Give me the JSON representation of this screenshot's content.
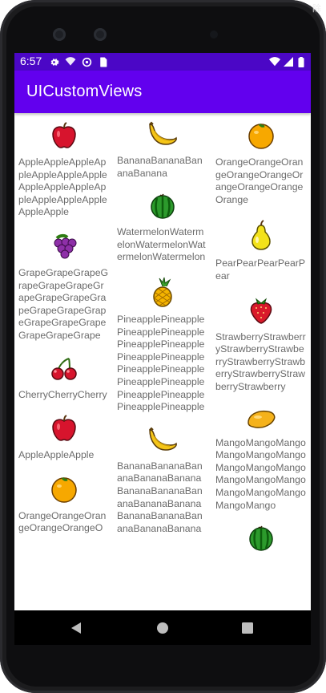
{
  "system": {
    "time": "6:57",
    "corner_text": "除"
  },
  "app": {
    "title": "UICustomViews"
  },
  "grid": {
    "columns": [
      [
        {
          "icon": "apple-icon",
          "label": "AppleAppleAppleAppleAppleAppleAppleAppleAppleAppleAppleAppleAppleAppleAppleApple"
        },
        {
          "icon": "grape-icon",
          "label": "GrapeGrapeGrapeGrapeGrapeGrapeGrapeGrapeGrapeGrapeGrapeGrapeGrapeGrapeGrapeGrapeGrapeGrapeGrape"
        },
        {
          "icon": "cherry-icon",
          "label": "CherryCherryCherry"
        },
        {
          "icon": "apple-icon",
          "label": "AppleAppleApple"
        },
        {
          "icon": "orange-icon",
          "label": "OrangeOrangeOrangeOrangeOrangeO"
        }
      ],
      [
        {
          "icon": "banana-icon",
          "label": "BananaBananaBananaBanana"
        },
        {
          "icon": "watermelon-icon",
          "label": "WatermelonWatermelonWatermelonWatermelonWatermelon"
        },
        {
          "icon": "pineapple-icon",
          "label": "PineapplePineapplePineapplePineapplePineapplePineapplePineapplePineapplePineapplePineapplePineapplePineapplePineapplePineapplePineapplePineapple"
        },
        {
          "icon": "banana-icon",
          "label": "BananaBananaBananaBananaBananaBananaBananaBananaBananaBananaBananaBananaBananaBananaBanana"
        }
      ],
      [
        {
          "icon": "orange-icon",
          "label": "OrangeOrangeOrangeOrangeOrangeOrangeOrangeOrangeOrange"
        },
        {
          "icon": "pear-icon",
          "label": "PearPearPearPearPear"
        },
        {
          "icon": "strawberry-icon",
          "label": "StrawberryStrawberryStrawberryStrawberryStrawberryStrawberryStrawberryStrawberryStrawberry"
        },
        {
          "icon": "mango-icon",
          "label": "MangoMangoMangoMangoMangoMangoMangoMangoMangoMangoMangoMangoMangoMangoMangoMangoMango"
        },
        {
          "icon": "watermelon-icon",
          "label": ""
        }
      ]
    ]
  },
  "colors": {
    "status_bar": "#4b07c6",
    "app_bar": "#6200ee",
    "label_text": "#6b6b6b"
  }
}
